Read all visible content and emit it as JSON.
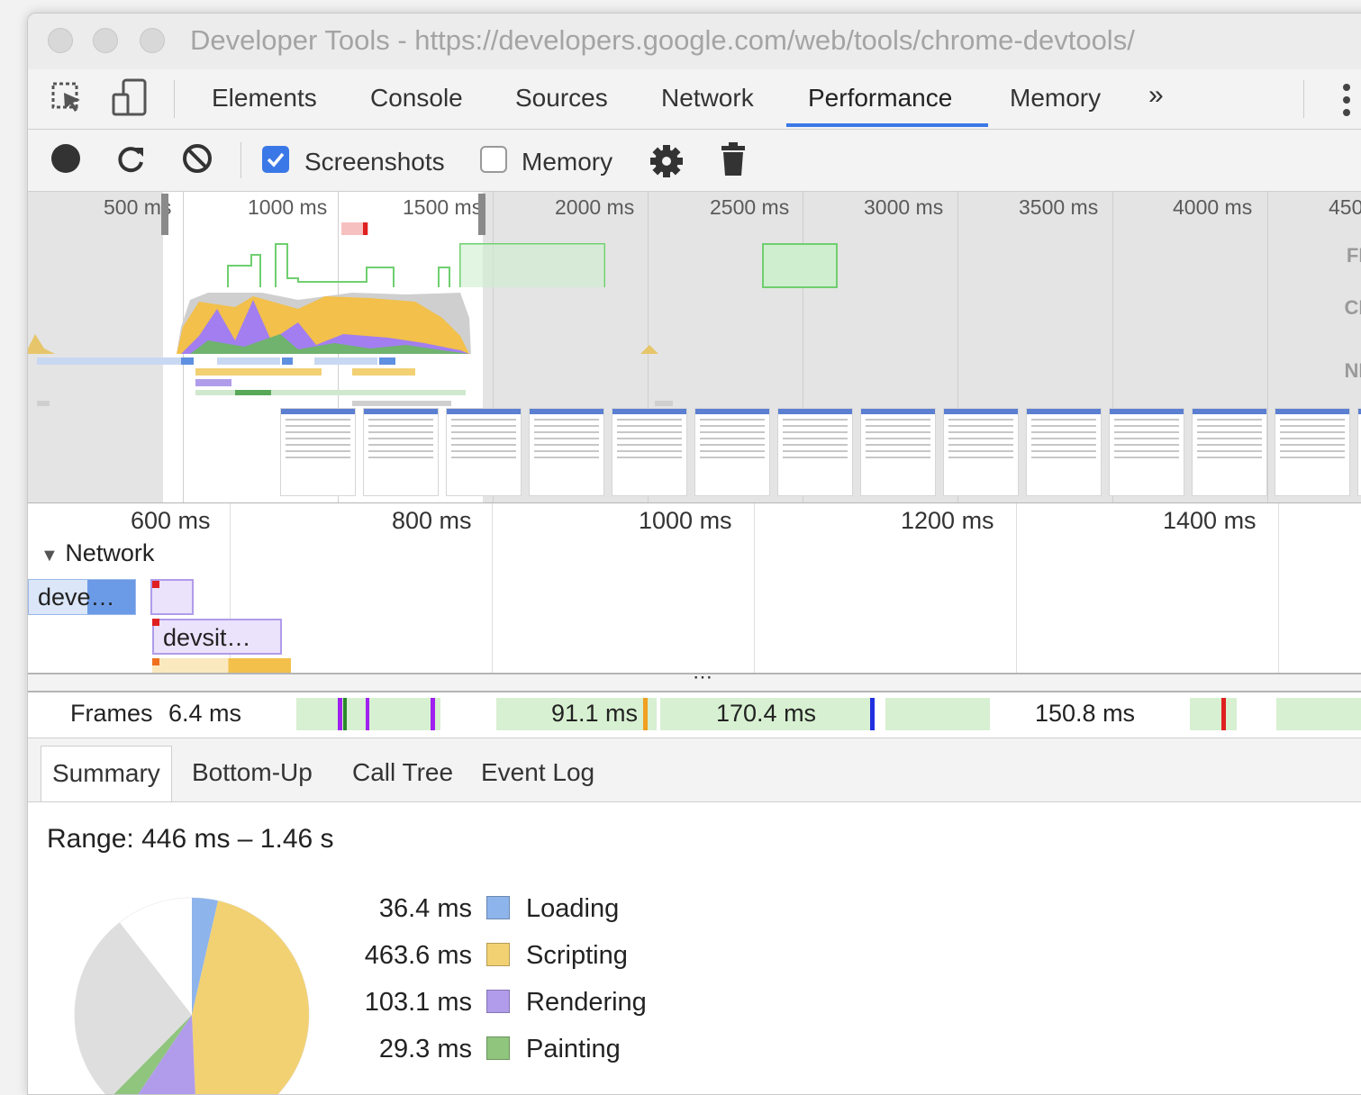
{
  "window": {
    "title": "Developer Tools - https://developers.google.com/web/tools/chrome-devtools/"
  },
  "tabs": {
    "items": [
      "Elements",
      "Console",
      "Sources",
      "Network",
      "Performance",
      "Memory"
    ],
    "active": "Performance",
    "overflow_glyph": "»"
  },
  "toolbar": {
    "screenshots_label": "Screenshots",
    "screenshots_checked": true,
    "memory_label": "Memory",
    "memory_checked": false,
    "icons": [
      "record-icon",
      "reload-icon",
      "clear-icon",
      "gear-icon",
      "trash-icon"
    ]
  },
  "overview": {
    "ticks": [
      "500 ms",
      "1000 ms",
      "1500 ms",
      "2000 ms",
      "2500 ms",
      "3000 ms",
      "3500 ms",
      "4000 ms",
      "450"
    ],
    "labels": {
      "fps": "FP",
      "cpu": "CP",
      "net": "NE"
    }
  },
  "timeline": {
    "ticks": [
      "600 ms",
      "800 ms",
      "1000 ms",
      "1200 ms",
      "1400 ms"
    ],
    "network_title": "Network",
    "requests": [
      "deve…",
      "devsit…"
    ]
  },
  "splitter": {
    "glyph": "⋯"
  },
  "frames": {
    "label": "Frames",
    "values": [
      "6.4 ms",
      "91.1 ms",
      "170.4 ms",
      "150.8 ms"
    ]
  },
  "bottom_tabs": {
    "items": [
      "Summary",
      "Bottom-Up",
      "Call Tree",
      "Event Log"
    ],
    "active": "Summary"
  },
  "summary": {
    "range": "Range: 446 ms – 1.46 s",
    "categories": [
      {
        "value": "36.4 ms",
        "name": "Loading",
        "color": "#8eb4ec"
      },
      {
        "value": "463.6 ms",
        "name": "Scripting",
        "color": "#f2d173"
      },
      {
        "value": "103.1 ms",
        "name": "Rendering",
        "color": "#b09cea"
      },
      {
        "value": "29.3 ms",
        "name": "Painting",
        "color": "#8fc57d"
      }
    ]
  },
  "colors": {
    "accent": "#3b78e7",
    "loading": "#8eb4ec",
    "scripting": "#f2d173",
    "rendering": "#b09cea",
    "painting": "#8fc57d"
  }
}
